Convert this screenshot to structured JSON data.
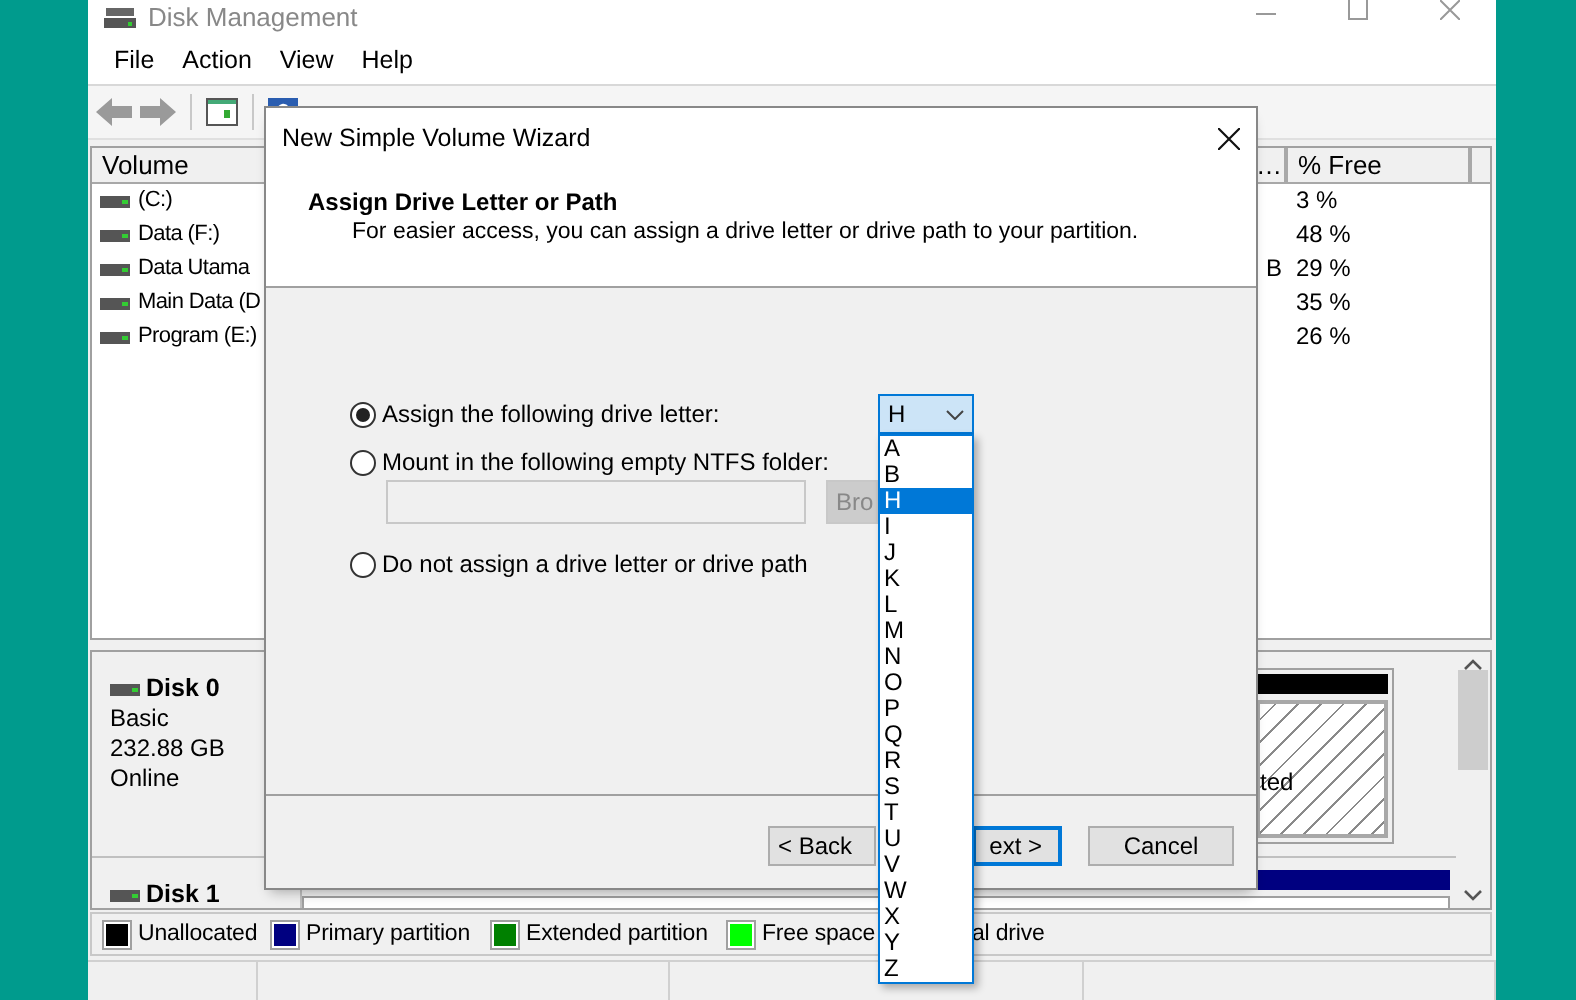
{
  "window": {
    "title": "Disk Management"
  },
  "menu": [
    "File",
    "Action",
    "View",
    "Help"
  ],
  "volume_table": {
    "columns": [
      "Volume",
      "…",
      "% Free"
    ],
    "rows": [
      {
        "volume": "(C:)",
        "free": "3 %"
      },
      {
        "volume": "Data (F:)",
        "free": "48 %"
      },
      {
        "volume": "Data Utama",
        "column_2": "B",
        "free": "29 %"
      },
      {
        "volume": "Main Data (D",
        "free": "35 %"
      },
      {
        "volume": "Program (E:)",
        "free": "26 %"
      }
    ]
  },
  "disks": [
    {
      "name": "Disk 0",
      "type": "Basic",
      "size": "232.88 GB",
      "status": "Online",
      "partitions": [
        {
          "kind": "unallocated",
          "label": "ted"
        }
      ]
    },
    {
      "name": "Disk 1",
      "partitions": [
        {
          "kind": "primary"
        }
      ]
    }
  ],
  "legend": [
    {
      "label": "Unallocated",
      "color": "#000000"
    },
    {
      "label": "Primary partition",
      "color": "#000080"
    },
    {
      "label": "Extended partition",
      "color": "#008000"
    },
    {
      "label": "Free space",
      "color": "#00ff00"
    },
    {
      "label": "al drive"
    }
  ],
  "dialog": {
    "title": "New Simple Volume Wizard",
    "heading": "Assign Drive Letter or Path",
    "description": "For easier access, you can assign a drive letter or drive path to your partition.",
    "options": [
      {
        "kind": "letter",
        "label": "Assign the following drive letter:",
        "selected": true
      },
      {
        "kind": "folder",
        "label": "Mount in the following empty NTFS folder:",
        "selected": false
      },
      {
        "kind": "none",
        "label": "Do not assign a drive letter or drive path",
        "selected": false
      }
    ],
    "drive_letter": {
      "value": "H",
      "expanded": true,
      "options": [
        {
          "label": "A",
          "selected": false
        },
        {
          "label": "B",
          "selected": false
        },
        {
          "label": "H",
          "selected": true
        },
        {
          "label": "I",
          "selected": false
        },
        {
          "label": "J",
          "selected": false
        },
        {
          "label": "K",
          "selected": false
        },
        {
          "label": "L",
          "selected": false
        },
        {
          "label": "M",
          "selected": false
        },
        {
          "label": "N",
          "selected": false
        },
        {
          "label": "O",
          "selected": false
        },
        {
          "label": "P",
          "selected": false
        },
        {
          "label": "Q",
          "selected": false
        },
        {
          "label": "R",
          "selected": false
        },
        {
          "label": "S",
          "selected": false
        },
        {
          "label": "T",
          "selected": false
        },
        {
          "label": "U",
          "selected": false
        },
        {
          "label": "V",
          "selected": false
        },
        {
          "label": "W",
          "selected": false
        },
        {
          "label": "X",
          "selected": false
        },
        {
          "label": "Y",
          "selected": false
        },
        {
          "label": "Z",
          "selected": false
        }
      ]
    },
    "browse_button": "Bro",
    "buttons": [
      {
        "kind": "back",
        "label": "< Back",
        "focused": false
      },
      {
        "kind": "next",
        "label": "ext >",
        "focused": true
      },
      {
        "kind": "cancel",
        "label": "Cancel",
        "focused": false
      }
    ]
  }
}
